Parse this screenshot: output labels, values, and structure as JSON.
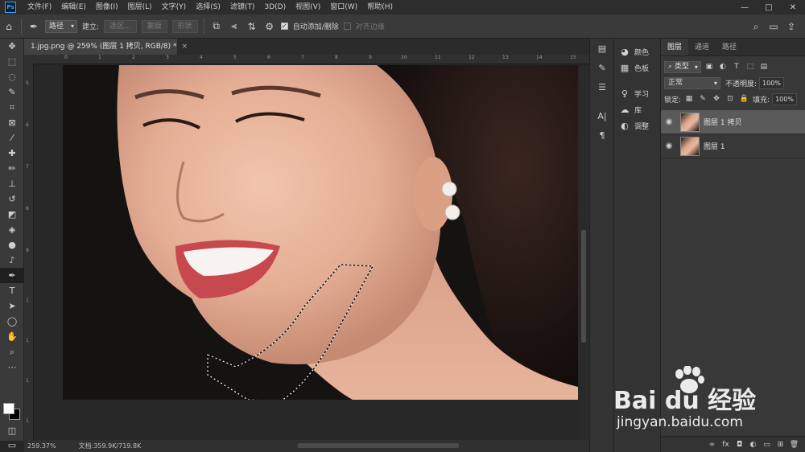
{
  "app": {
    "logo": "Ps"
  },
  "menu": [
    "文件(F)",
    "编辑(E)",
    "图像(I)",
    "图层(L)",
    "文字(Y)",
    "选择(S)",
    "滤镜(T)",
    "3D(D)",
    "视图(V)",
    "窗口(W)",
    "帮助(H)"
  ],
  "window_controls": {
    "minimize": "—",
    "maximize": "□",
    "close": "✕"
  },
  "options": {
    "mode_select": "路径",
    "make_label": "建立:",
    "selection_btn": "选区...",
    "mask_btn": "蒙版",
    "shape_btn": "形状",
    "auto_add_delete_label": "自动添加/删除",
    "auto_add_delete_checked": true,
    "align_edges_label": "对齐边缘",
    "align_edges_checked": false
  },
  "document": {
    "tab_title": "1.jpg.png @ 259% (图层 1 拷贝, RGB/8) *",
    "close_glyph": "×",
    "ruler_top": [
      "0",
      "1",
      "2",
      "3",
      "4",
      "5",
      "6",
      "7",
      "8",
      "9",
      "10",
      "11",
      "12",
      "13",
      "14",
      "15"
    ],
    "ruler_left": [
      "5",
      "6",
      "7",
      "8",
      "9",
      "1",
      "1",
      "1",
      "1"
    ]
  },
  "status": {
    "zoom": "259.37%",
    "doc_info": "文档:359.9K/719.8K"
  },
  "right_dock": {
    "color_label": "颜色",
    "swatches_label": "色板",
    "learn_label": "学习",
    "library_label": "库",
    "adjust_label": "调整"
  },
  "layers_panel": {
    "tabs": [
      "图层",
      "通道",
      "路径"
    ],
    "filter_select": "类型",
    "blend_mode": "正常",
    "opacity_label": "不透明度:",
    "opacity_value": "100%",
    "lock_label": "锁定:",
    "fill_label": "填充:",
    "fill_value": "100%",
    "layers": [
      {
        "name": "图层 1 拷贝",
        "visible": true,
        "selected": true
      },
      {
        "name": "图层 1",
        "visible": true,
        "selected": false
      }
    ]
  },
  "watermark": {
    "brand": "Bai du 经验",
    "url": "jingyan.baidu.com"
  },
  "colors": {
    "foreground": "#ffffff",
    "background": "#000000",
    "accent": "#31a8ff"
  }
}
